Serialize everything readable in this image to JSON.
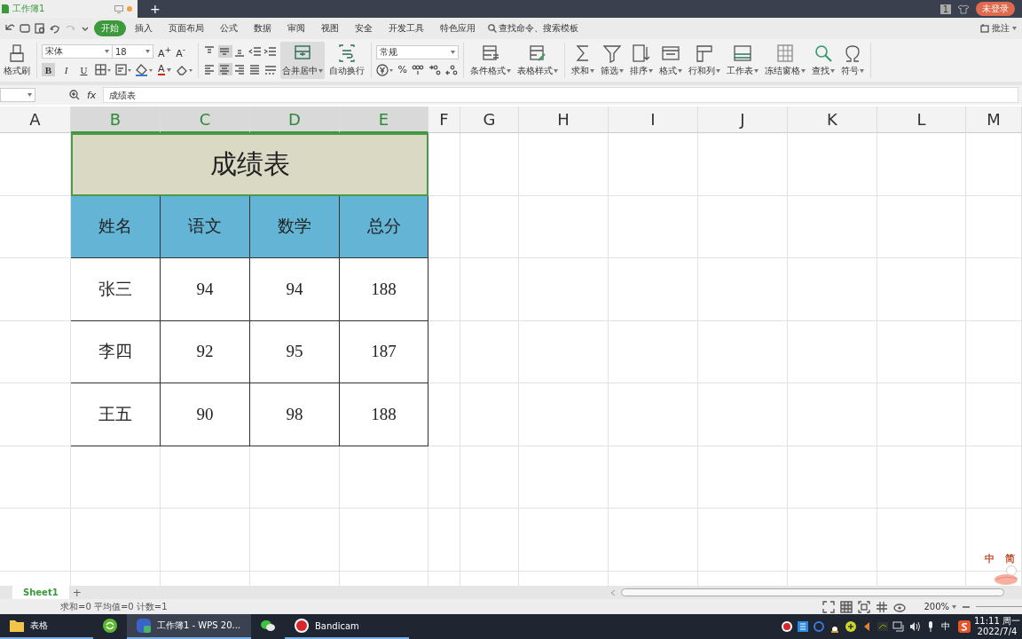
{
  "title_bar": {
    "document_tab": "工作簿1",
    "unsaved": true,
    "new_tab": "+",
    "counter": "1",
    "account": "未登录"
  },
  "menu": {
    "tabs": [
      {
        "label": "开始",
        "selected": true
      },
      {
        "label": "插入",
        "selected": false
      },
      {
        "label": "页面布局",
        "selected": false
      },
      {
        "label": "公式",
        "selected": false
      },
      {
        "label": "数据",
        "selected": false
      },
      {
        "label": "审阅",
        "selected": false
      },
      {
        "label": "视图",
        "selected": false
      },
      {
        "label": "安全",
        "selected": false
      },
      {
        "label": "开发工具",
        "selected": false
      },
      {
        "label": "特色应用",
        "selected": false
      }
    ],
    "search": "查找命令、搜索模板",
    "comment": "批注"
  },
  "ribbon": {
    "format_painter": "格式刷",
    "font": "宋体",
    "font_size": "18",
    "grow_font": "A$^{+}$",
    "shrink_font": "A$^{-}$",
    "styles": [
      {
        "label": "B",
        "selected": true
      },
      {
        "label": "I",
        "selected": false
      },
      {
        "label": "U",
        "selected": false
      }
    ],
    "font_color": "A",
    "vertical_align": [
      {
        "selected": false
      },
      {
        "selected": true
      },
      {
        "selected": false
      }
    ],
    "horizontal_align": [
      {
        "selected": false
      },
      {
        "selected": true
      },
      {
        "selected": false
      },
      {
        "selected": false
      }
    ],
    "merge": {
      "label": "合并居中",
      "selected": true
    },
    "wrap": "自动换行",
    "number_format": "常规",
    "percent": "%",
    "tools": [
      {
        "label": "条件格式"
      },
      {
        "label": "表格样式"
      },
      {
        "label": "求和"
      },
      {
        "label": "筛选"
      },
      {
        "label": "排序"
      },
      {
        "label": "格式"
      },
      {
        "label": "行和列"
      },
      {
        "label": "工作表"
      },
      {
        "label": "冻结窗格"
      },
      {
        "label": "查找"
      },
      {
        "label": "符号"
      }
    ]
  },
  "formula_bar": {
    "fx": "fx",
    "content": "成绩表"
  },
  "sheet": {
    "column_headers": [
      {
        "label": "A",
        "selected": false
      },
      {
        "label": "B",
        "selected": true
      },
      {
        "label": "C",
        "selected": true
      },
      {
        "label": "D",
        "selected": true
      },
      {
        "label": "E",
        "selected": true
      },
      {
        "label": "F",
        "selected": false
      },
      {
        "label": "G",
        "selected": false
      },
      {
        "label": "H",
        "selected": false
      },
      {
        "label": "I",
        "selected": false
      },
      {
        "label": "J",
        "selected": false
      },
      {
        "label": "K",
        "selected": false
      },
      {
        "label": "L",
        "selected": false
      },
      {
        "label": "M",
        "selected": false
      }
    ]
  },
  "table": {
    "title": "成绩表",
    "headers": [
      "姓名",
      "语文",
      "数学",
      "总分"
    ],
    "rows": [
      [
        "张三",
        "94",
        "94",
        "188"
      ],
      [
        "李四",
        "92",
        "95",
        "187"
      ],
      [
        "王五",
        "90",
        "98",
        "188"
      ]
    ]
  },
  "sheet_tabs": [
    {
      "label": "Sheet1",
      "selected": true
    }
  ],
  "add_sheet": "+",
  "ime_float": [
    "中",
    "简"
  ],
  "status_bar": {
    "summary": "求和=0 平均值=0 计数=1",
    "views": [
      {
        "selected": false
      },
      {
        "selected": true
      },
      {
        "selected": false
      },
      {
        "selected": false
      },
      {
        "selected": false
      }
    ],
    "zoom": "200%"
  },
  "taskbar": {
    "items": [
      {
        "label": "表格",
        "active": false,
        "open": true
      },
      {
        "active": false,
        "open": false
      },
      {
        "label": "工作簿1 - WPS 20...",
        "active": true,
        "open": true
      },
      {
        "active": false,
        "open": false
      },
      {
        "label": "Bandicam",
        "active": false,
        "open": true
      }
    ],
    "input_mode": "中",
    "time": "11:11 周一",
    "date": "2022/7/4"
  }
}
